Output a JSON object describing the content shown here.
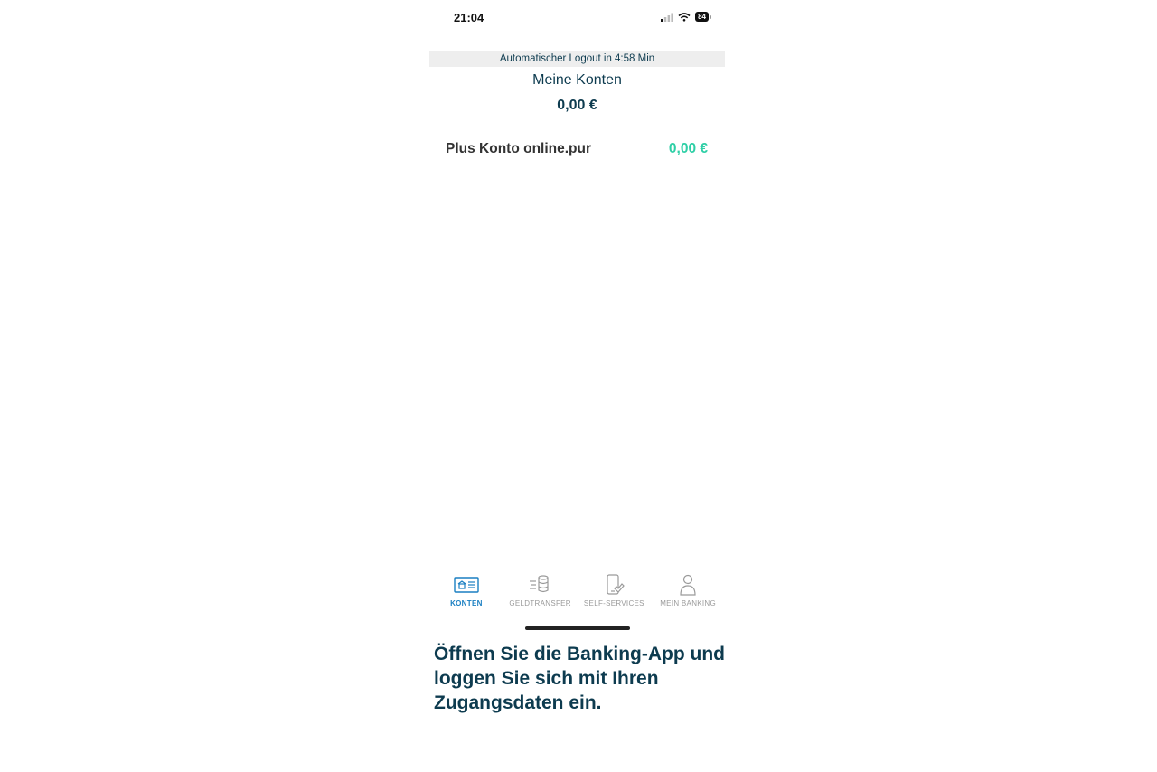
{
  "status_bar": {
    "time": "21:04",
    "battery": "84",
    "icons": [
      "signal-icon",
      "wifi-icon",
      "battery-icon"
    ]
  },
  "banner": {
    "logout_text": "Automatischer Logout in 4:58 Min"
  },
  "header": {
    "title": "Meine Konten",
    "total": "0,00 €"
  },
  "accounts": [
    {
      "name": "Plus Konto online.pur",
      "balance": "0,00 €"
    }
  ],
  "tabbar": {
    "tabs": [
      {
        "label": "KONTEN",
        "icon": "account-card-icon",
        "active": true
      },
      {
        "label": "GELDTRANSFER",
        "icon": "coins-transfer-icon",
        "active": false
      },
      {
        "label": "SELF-SERVICES",
        "icon": "phone-service-icon",
        "active": false
      },
      {
        "label": "MEIN BANKING",
        "icon": "person-icon",
        "active": false
      }
    ]
  },
  "caption": "Öffnen Sie die Banking-App und loggen Sie sich mit Ihren Zugangsdaten ein.",
  "colors": {
    "primary_text": "#0d3b4f",
    "balance_accent": "#2ecfa6",
    "active_tab": "#1a7fc2",
    "inactive_tab": "#9a9a9a"
  }
}
